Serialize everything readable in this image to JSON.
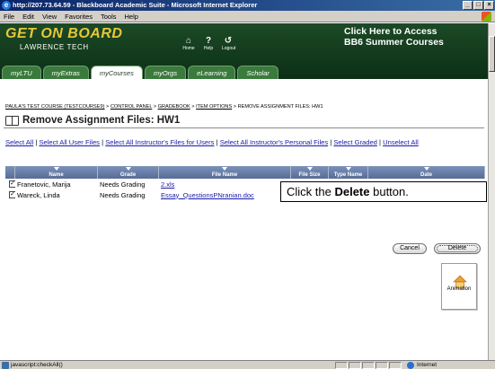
{
  "window": {
    "title": "http://207.73.64.59 - Blackboard Academic Suite - Microsoft Internet Explorer",
    "min": "_",
    "max": "□",
    "close": "×"
  },
  "menu": [
    "File",
    "Edit",
    "View",
    "Favorites",
    "Tools",
    "Help"
  ],
  "header": {
    "logo_line1": "GET ON BOARD",
    "logo_line2": "LAWRENCE TECH",
    "icons": [
      {
        "name": "home-icon",
        "glyph": "⌂",
        "label": "Home"
      },
      {
        "name": "help-icon",
        "glyph": "?",
        "label": "Help"
      },
      {
        "name": "logout-icon",
        "glyph": "↺",
        "label": "Logout"
      }
    ],
    "promo_line1": "Click Here to Access",
    "promo_line2": "BB6 Summer Courses"
  },
  "tabs": [
    {
      "label": "myLTU",
      "active": false
    },
    {
      "label": "myExtras",
      "active": false
    },
    {
      "label": "myCourses",
      "active": true
    },
    {
      "label": "myOrgs",
      "active": false
    },
    {
      "label": "eLearning",
      "active": false
    },
    {
      "label": "Scholar",
      "active": false
    }
  ],
  "breadcrumb": {
    "items": [
      "PAULA'S TEST COURSE (TESTCOURSE9)",
      "CONTROL PANEL",
      "GRADEBOOK",
      "ITEM OPTIONS"
    ],
    "current": "REMOVE ASSIGNMENT FILES: HW1",
    "separator": " > "
  },
  "page_title": "Remove Assignment Files: HW1",
  "select_links": [
    "Select All",
    "Select All User Files",
    "Select All Instructor's Files for Users",
    "Select All Instructor's Personal Files",
    "Select Graded",
    "Unselect All"
  ],
  "table": {
    "columns": [
      "Name",
      "Grade",
      "File Name",
      "File Size",
      "Type Name",
      "Date"
    ],
    "rows": [
      {
        "checked": true,
        "name": "Franetovic, Marija",
        "grade": "Needs Grading",
        "file": "2.xls"
      },
      {
        "checked": true,
        "name": "Wareck, Linda",
        "grade": "Needs Grading",
        "file": "Essay_QuestionsPNranian.doc"
      }
    ]
  },
  "callout": {
    "prefix": "Click the ",
    "emphasis": "Delete",
    "suffix": " button."
  },
  "buttons": {
    "cancel": "Cancel",
    "delete": "Delete"
  },
  "animation_label": "Animation",
  "status": {
    "text": "javascript:checkAll()",
    "zone": "Internet"
  },
  "colors": {
    "header_green": "#0b2f16",
    "logo_gold": "#e8c63a",
    "table_header": "#6a7fa8",
    "link_blue": "#1a1aaa"
  }
}
